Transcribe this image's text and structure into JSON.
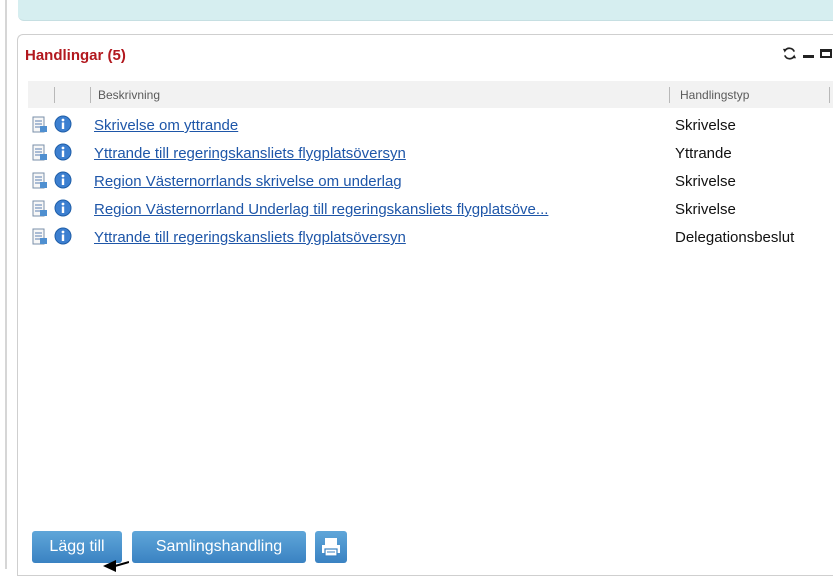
{
  "panel": {
    "title": "Handlingar (5)",
    "tools": [
      "refresh-icon",
      "minimize-icon",
      "maximize-icon"
    ]
  },
  "table": {
    "columns": [
      "Beskrivning",
      "Handlingstyp"
    ],
    "rows": [
      {
        "description": "Skrivelse om yttrande",
        "type": "Skrivelse"
      },
      {
        "description": "Yttrande till regeringskansliets flygplatsöversyn",
        "type": "Yttrande"
      },
      {
        "description": "Region Västernorrlands skrivelse om underlag",
        "type": "Skrivelse"
      },
      {
        "description": "Region Västernorrland Underlag till regeringskansliets flygplatsöve...",
        "type": "Skrivelse"
      },
      {
        "description": "Yttrande till regeringskansliets flygplatsöversyn",
        "type": "Delegationsbeslut"
      }
    ],
    "row_icons": [
      "document-icon",
      "info-icon"
    ]
  },
  "footer": {
    "add_label": "Lägg till",
    "collection_label": "Samlingshandling",
    "print_icon": "print-icon"
  },
  "colors": {
    "title": "#b2181e",
    "link": "#1e56a8",
    "button": "#4a94cf",
    "top_band": "#d6eef0"
  }
}
